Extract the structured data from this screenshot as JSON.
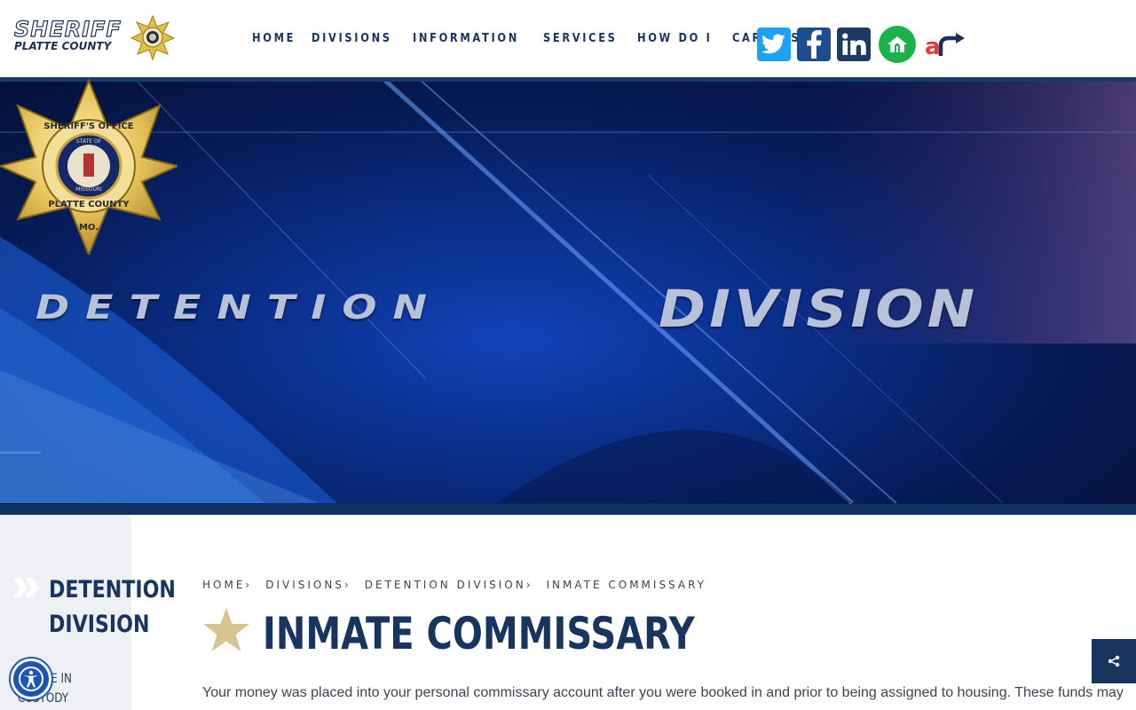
{
  "header": {
    "logo_line1": "SHERIFF",
    "logo_line2": "PLATTE COUNTY",
    "nav": [
      "HOME",
      "DIVISIONS",
      "INFORMATION",
      "SERVICES",
      "HOW DO I",
      "CAREERS"
    ],
    "social": [
      "twitter-icon",
      "facebook-icon",
      "linkedin-icon",
      "nextdoor-icon",
      "arrest-reports-icon"
    ]
  },
  "hero": {
    "word_left": "DETENTION",
    "word_right": "DIVISION",
    "badge_top": "SHERIFF'S OFFICE",
    "badge_mid": "STATE OF",
    "badge_seal": "MISSOURI",
    "badge_county": "PLATTE COUNTY",
    "badge_bottom": "MO."
  },
  "sidebar": {
    "title_line1": "DETENTION",
    "title_line2": "DIVISION",
    "link": "INMATE IN CUSTODY"
  },
  "breadcrumb": [
    "HOME",
    "DIVISIONS",
    "DETENTION DIVISION",
    "INMATE COMMISSARY"
  ],
  "main": {
    "title": "INMATE COMMISSARY",
    "body": "Your money was placed into your personal commissary account after you were booked in and prior to being assigned to housing. These funds may"
  },
  "colors": {
    "navy": "#17355e",
    "gold": "#d8c48e",
    "twitter": "#1da1f2",
    "facebook": "#1c4e8f",
    "nextdoor": "#1bb24b"
  }
}
